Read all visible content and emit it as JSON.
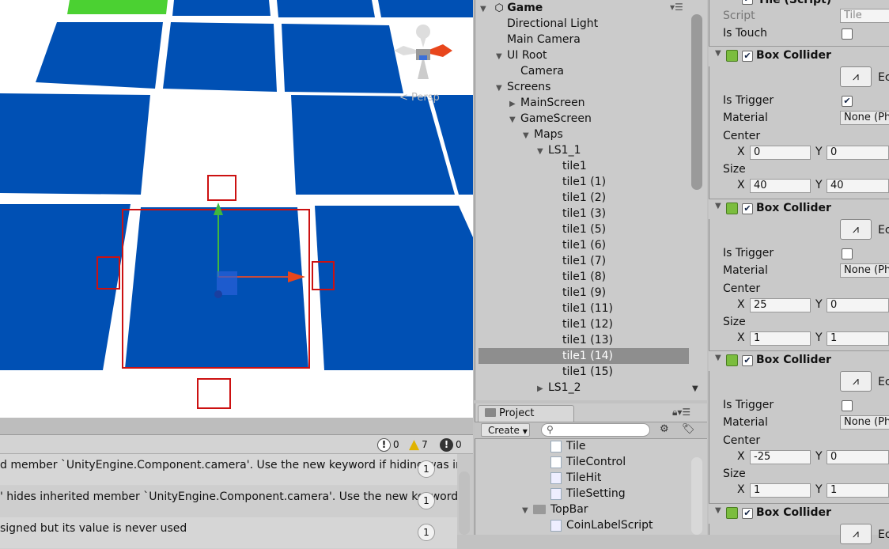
{
  "scene": {
    "persp_label": "< Persp",
    "colors": {
      "tile": "#0050b4",
      "green_tile": "#4bd132",
      "selection": "#cc1111"
    }
  },
  "console": {
    "counts": {
      "info": "0",
      "warnings": "7",
      "errors": "0"
    },
    "lines": [
      {
        "text": "d member `UnityEngine.Component.camera'. Use the new keyword if hiding was in",
        "count": "1"
      },
      {
        "text": "' hides inherited member `UnityEngine.Component.camera'. Use the new keyword",
        "count": "1"
      },
      {
        "text": "signed but its value is never used",
        "count": "1"
      }
    ]
  },
  "hierarchy": {
    "scene_name": "Game",
    "rows": [
      {
        "label": "Directional Light",
        "arrow": ""
      },
      {
        "label": "Main Camera",
        "arrow": ""
      },
      {
        "label": "UI Root",
        "arrow": "▼"
      },
      {
        "label": "Camera",
        "arrow": ""
      },
      {
        "label": "Screens",
        "arrow": "▼"
      },
      {
        "label": "MainScreen",
        "arrow": "▶"
      },
      {
        "label": "GameScreen",
        "arrow": "▼"
      },
      {
        "label": "Maps",
        "arrow": "▼"
      },
      {
        "label": "LS1_1",
        "arrow": "▼"
      },
      {
        "label": "tile1",
        "arrow": ""
      },
      {
        "label": "tile1 (1)",
        "arrow": ""
      },
      {
        "label": "tile1 (2)",
        "arrow": ""
      },
      {
        "label": "tile1 (3)",
        "arrow": ""
      },
      {
        "label": "tile1 (5)",
        "arrow": ""
      },
      {
        "label": "tile1 (6)",
        "arrow": ""
      },
      {
        "label": "tile1 (7)",
        "arrow": ""
      },
      {
        "label": "tile1 (8)",
        "arrow": ""
      },
      {
        "label": "tile1 (9)",
        "arrow": ""
      },
      {
        "label": "tile1 (11)",
        "arrow": ""
      },
      {
        "label": "tile1 (12)",
        "arrow": ""
      },
      {
        "label": "tile1 (13)",
        "arrow": ""
      },
      {
        "label": "tile1 (14)",
        "arrow": "",
        "selected": true
      },
      {
        "label": "tile1 (15)",
        "arrow": ""
      },
      {
        "label": "LS1_2",
        "arrow": "▶"
      }
    ]
  },
  "project": {
    "tab": "Project",
    "create_label": "Create",
    "items": [
      {
        "label": "Tile",
        "kind": "script"
      },
      {
        "label": "TileControl",
        "kind": "script"
      },
      {
        "label": "TileHit",
        "kind": "cs"
      },
      {
        "label": "TileSetting",
        "kind": "cs"
      },
      {
        "label": "TopBar",
        "kind": "folder"
      },
      {
        "label": "CoinLabelScript",
        "kind": "cs"
      }
    ]
  },
  "inspector": {
    "tile_script": {
      "title": "Tile (Script)",
      "script_label": "Script",
      "script_value": "Tile",
      "is_touch_label": "Is Touch"
    },
    "box_colliders": [
      {
        "title": "Box Collider",
        "edit": "Ec",
        "is_trigger": "Is Trigger",
        "trigger_checked": true,
        "material": "Material",
        "material_value": "None (Ph",
        "center": "Center",
        "center_x": "0",
        "center_y": "0",
        "size": "Size",
        "size_x": "40",
        "size_y": "40"
      },
      {
        "title": "Box Collider",
        "edit": "Ec",
        "is_trigger": "Is Trigger",
        "trigger_checked": false,
        "material": "Material",
        "material_value": "None (Ph",
        "center": "Center",
        "center_x": "25",
        "center_y": "0",
        "size": "Size",
        "size_x": "1",
        "size_y": "1"
      },
      {
        "title": "Box Collider",
        "edit": "Ec",
        "is_trigger": "Is Trigger",
        "trigger_checked": false,
        "material": "Material",
        "material_value": "None (Ph",
        "center": "Center",
        "center_x": "-25",
        "center_y": "0",
        "size": "Size",
        "size_x": "1",
        "size_y": "1"
      },
      {
        "title": "Box Collider",
        "edit": "Ec"
      }
    ],
    "x": "X",
    "y": "Y"
  }
}
